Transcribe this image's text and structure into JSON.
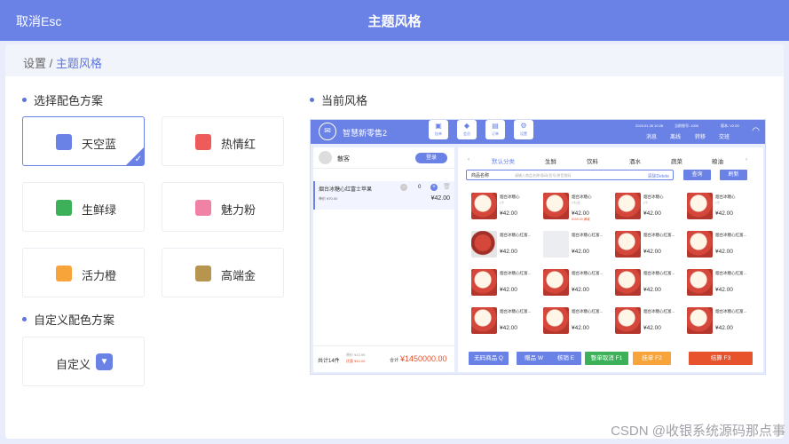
{
  "header": {
    "cancel": "取消Esc",
    "title": "主题风格"
  },
  "breadcrumb": {
    "parent": "设置",
    "current": "主题风格"
  },
  "section_select": "选择配色方案",
  "schemes": [
    {
      "label": "天空蓝",
      "color": "#6a82e6",
      "selected": true
    },
    {
      "label": "热情红",
      "color": "#ee5b5b",
      "selected": false
    },
    {
      "label": "生鲜绿",
      "color": "#3db05a",
      "selected": false
    },
    {
      "label": "魅力粉",
      "color": "#f082a5",
      "selected": false
    },
    {
      "label": "活力橙",
      "color": "#f7a43b",
      "selected": false
    },
    {
      "label": "高端金",
      "color": "#b8954f",
      "selected": false
    }
  ],
  "section_custom": "自定义配色方案",
  "custom": {
    "label": "自定义",
    "icon": "chevron-down-icon"
  },
  "section_preview": "当前风格",
  "preview": {
    "brand": "智慧新零售2",
    "toolbar": [
      "挂单",
      "会员",
      "订单",
      "设置"
    ],
    "meta": [
      "2023.01.26 10:28",
      "当前账号: 1000",
      "版本: V2.00"
    ],
    "top_links": [
      "消息",
      "离线",
      "转移",
      "交班"
    ],
    "customer": "散客",
    "login": "登录",
    "cart_item": {
      "name": "烟台冰糖心红富士苹果",
      "unit_price": "单价 ¥70.00",
      "qty": "0",
      "total": "¥42.00"
    },
    "footer": {
      "count": "共计14件",
      "orig": "原价 ¥13.99",
      "discount": "优惠 ¥13.00",
      "total_label": "合计",
      "total": "¥1450000.00"
    },
    "categories": [
      "默认分类",
      "生鲜",
      "饮料",
      "酒水",
      "蔬菜",
      "粮油"
    ],
    "search": {
      "field": "商品名称",
      "placeholder": "请输入商品名称/条码/货号/拼音首码",
      "clear": "清除Delete"
    },
    "query": "查询",
    "refresh": "刷新",
    "products": [
      {
        "name": "烟台冰糖心",
        "spec": "/个",
        "price": "¥42.00",
        "promo": "",
        "img": "apple"
      },
      {
        "name": "烟台冰糖心",
        "spec": "/个/斤",
        "price": "¥42.00",
        "promo": "¥100.00 满减",
        "img": "apple"
      },
      {
        "name": "烟台冰糖心",
        "spec": "/个",
        "price": "¥42.00",
        "promo": "",
        "img": "apple"
      },
      {
        "name": "烟台冰糖心",
        "spec": "/个",
        "price": "¥42.00",
        "promo": "",
        "img": "apple"
      },
      {
        "name": "烟台冰糖心红富...",
        "spec": "",
        "price": "¥42.00",
        "promo": "",
        "img": "tag"
      },
      {
        "name": "烟台冰糖心红富...",
        "spec": "",
        "price": "¥42.00",
        "promo": "",
        "img": "placeholder"
      },
      {
        "name": "烟台冰糖心红富...",
        "spec": "",
        "price": "¥42.00",
        "promo": "",
        "img": "apple"
      },
      {
        "name": "烟台冰糖心红富...",
        "spec": "",
        "price": "¥42.00",
        "promo": "",
        "img": "apple"
      },
      {
        "name": "烟台冰糖心红富...",
        "spec": "",
        "price": "¥42.00",
        "promo": "",
        "img": "apple"
      },
      {
        "name": "烟台冰糖心红富...",
        "spec": "",
        "price": "¥42.00",
        "promo": "",
        "img": "apple"
      },
      {
        "name": "烟台冰糖心红富...",
        "spec": "",
        "price": "¥42.00",
        "promo": "",
        "img": "apple"
      },
      {
        "name": "烟台冰糖心红富...",
        "spec": "",
        "price": "¥42.00",
        "promo": "",
        "img": "apple"
      },
      {
        "name": "烟台冰糖心红富...",
        "spec": "",
        "price": "¥42.00",
        "promo": "",
        "img": "apple"
      },
      {
        "name": "烟台冰糖心红富...",
        "spec": "",
        "price": "¥42.00",
        "promo": "",
        "img": "apple"
      },
      {
        "name": "烟台冰糖心红富...",
        "spec": "",
        "price": "¥42.00",
        "promo": "",
        "img": "apple"
      },
      {
        "name": "烟台冰糖心红富...",
        "spec": "",
        "price": "¥42.00",
        "promo": "",
        "img": "apple"
      }
    ],
    "actions": [
      {
        "label": "无码商品 Q",
        "color": "#6a82e6"
      },
      {
        "label": "赠品 W",
        "color": "#6a82e6"
      },
      {
        "label": "核销 E",
        "color": "#6a82e6"
      },
      {
        "label": "整单取消 F1",
        "color": "#3db05a"
      },
      {
        "label": "挂单 F2",
        "color": "#f7a43b"
      },
      {
        "label": "结算 F3",
        "color": "#e7532c"
      }
    ]
  },
  "watermark": "CSDN @收银系统源码那点事"
}
